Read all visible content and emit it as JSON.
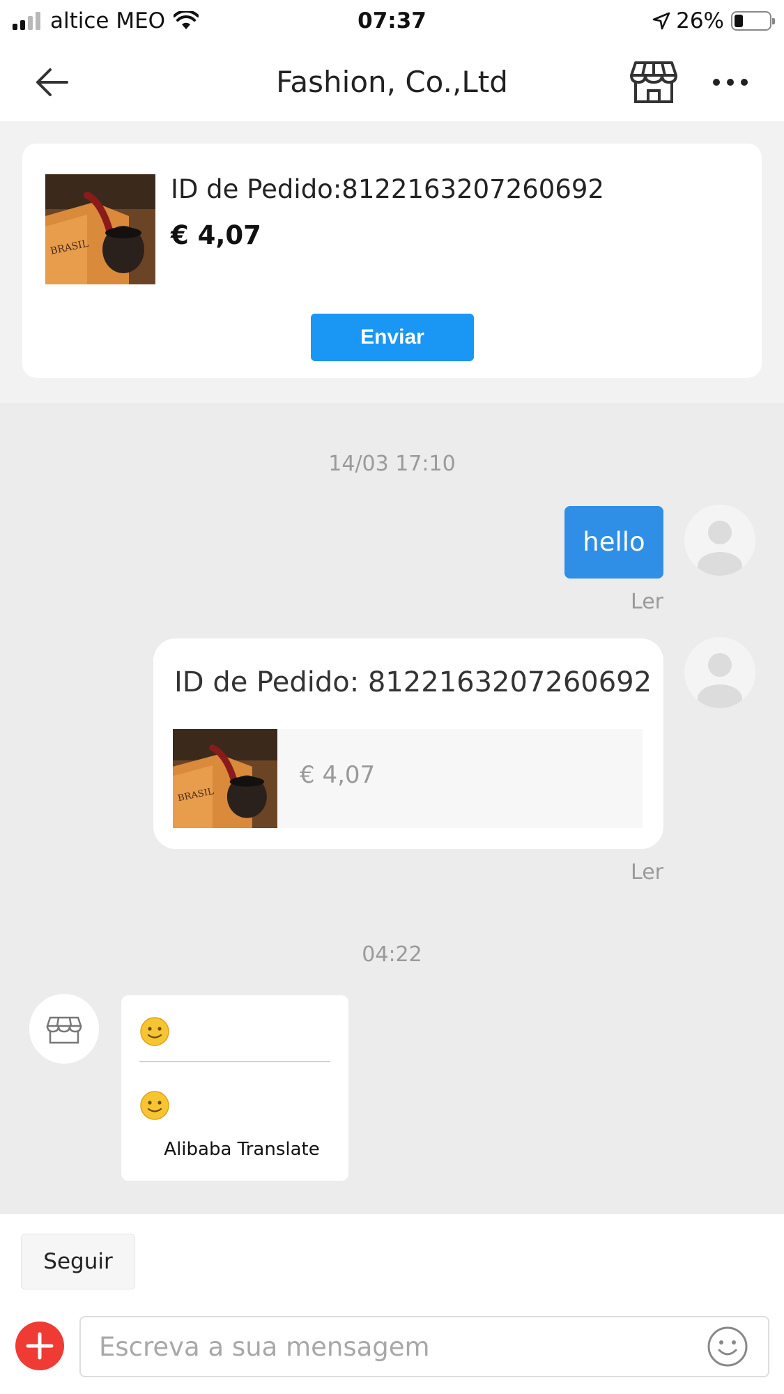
{
  "status_bar": {
    "carrier": "altice MEO",
    "time": "07:37",
    "battery_percent": "26%",
    "battery_level": 0.26,
    "icons": [
      "signal-icon",
      "wifi-icon",
      "location-arrow-icon",
      "battery-icon"
    ]
  },
  "nav": {
    "title": "Fashion, Co.,Ltd",
    "icons": [
      "back-arrow-icon",
      "store-icon",
      "more-icon"
    ]
  },
  "order_card": {
    "order_id": "ID de Pedido:8122163207260692",
    "price": "€ 4,07",
    "send_label": "Enviar",
    "accent": "#1a96f4"
  },
  "chat": {
    "timestamp_1": "14/03 17:10",
    "message_1": "hello",
    "read_1": "Ler",
    "order_message_id": "ID de Pedido: 8122163207260692",
    "order_message_price": "€ 4,07",
    "read_2": "Ler",
    "timestamp_2": "04:22",
    "translate_label": "Alibaba Translate",
    "bubble_color": "#2f8fe6"
  },
  "bottom": {
    "follow_label": "Seguir",
    "input_placeholder": "Escreva a sua mensagem",
    "plus_color": "#ef3b34"
  }
}
